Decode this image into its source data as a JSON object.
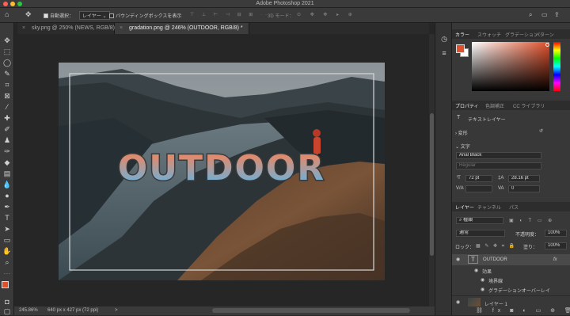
{
  "app": {
    "title": "Adobe Photoshop 2021"
  },
  "options_bar": {
    "auto_select_label": "自動選択：",
    "auto_select_value": "レイヤー",
    "bbox_label": "バウンディングボックスを表示",
    "mode_3d": "3D モード："
  },
  "tabs": [
    {
      "label": "sky.png @ 250% (NEWS, RGB/8) *",
      "close": "×"
    },
    {
      "label": "gradation.png @ 246% (OUTDOOR, RGB/8) *",
      "close": "×"
    }
  ],
  "canvas": {
    "text": "OUTDOOR",
    "colors": {
      "top": "#e08a6c",
      "bottom": "#6fb0d8",
      "stroke": "#3a3a3a"
    }
  },
  "status": {
    "zoom": "245.86%",
    "size": "640 px x 427 px (72 ppi)",
    "arrow": ">"
  },
  "color_panel": {
    "tabs": [
      "カラー",
      "スウォッチ",
      "グラデーション",
      "パターン"
    ],
    "fg": "#e0502a",
    "bg": "#ffffff"
  },
  "props_panel": {
    "tabs": [
      "プロパティ",
      "色調補正",
      "CC ライブラリ"
    ],
    "layer_type": "テキストレイヤー",
    "transform": "変形",
    "char": "文字",
    "font": "Arial Black",
    "style": "Regular",
    "size": "72 pt",
    "leading": "28.16 pt",
    "va": "V/A",
    "tracking": "0"
  },
  "layers_panel": {
    "tabs": [
      "レイヤー",
      "チャンネル",
      "パス"
    ],
    "search": "種類",
    "blend": "通常",
    "opacity_label": "不透明度：",
    "opacity": "100%",
    "lock_label": "ロック：",
    "fill_label": "塗り：",
    "fill": "100%",
    "layers": [
      {
        "name": "OUTDOOR",
        "fx": "fx"
      },
      {
        "name": "効果"
      },
      {
        "name": "境界線"
      },
      {
        "name": "グラデーションオーバーレイ"
      },
      {
        "name": "レイヤー 1"
      }
    ]
  }
}
